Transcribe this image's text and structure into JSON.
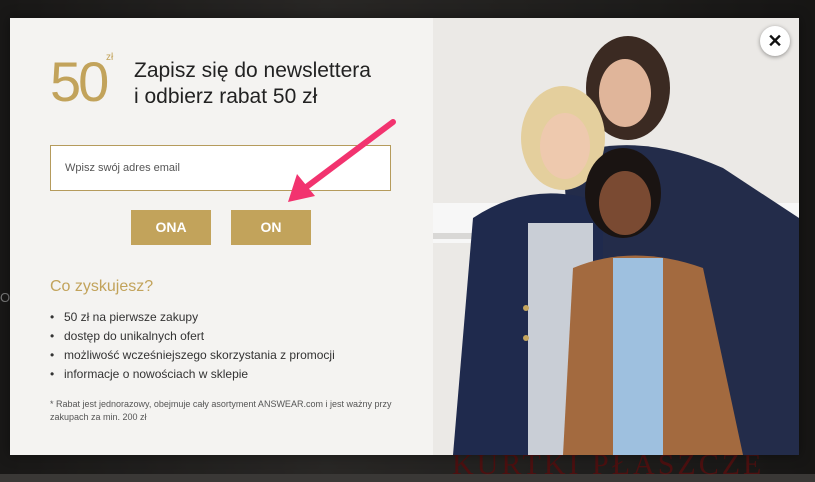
{
  "modal": {
    "badge": {
      "amount": "50",
      "currency": "zł"
    },
    "headline": [
      "Zapisz się do newslettera",
      "i odbierz rabat 50 zł"
    ],
    "email": {
      "placeholder": "Wpisz swój adres email",
      "value": ""
    },
    "buttons": {
      "female": "ONA",
      "male": "ON"
    },
    "benefits_title": "Co zyskujesz?",
    "benefits": [
      "50 zł na pierwsze zakupy",
      "dostęp do unikalnych ofert",
      "możliwość wcześniejszego skorzystania z promocji",
      "informacje o nowościach w sklepie"
    ],
    "footnote": "* Rabat jest jednorazowy, obejmuje cały asortyment ANSWEAR.com i jest ważny przy zakupach za min. 200 zł",
    "close_symbol": "✕"
  },
  "background": {
    "promo_text": "KURTKI PŁASZCZE",
    "left_text": "ON"
  },
  "colors": {
    "accent": "#c2a35b",
    "annotation_arrow": "#f2336f",
    "overlay": "rgba(0,0,0,0.45)"
  },
  "icons": {
    "close": "close-icon",
    "annotation": "arrow-pointer-icon"
  }
}
